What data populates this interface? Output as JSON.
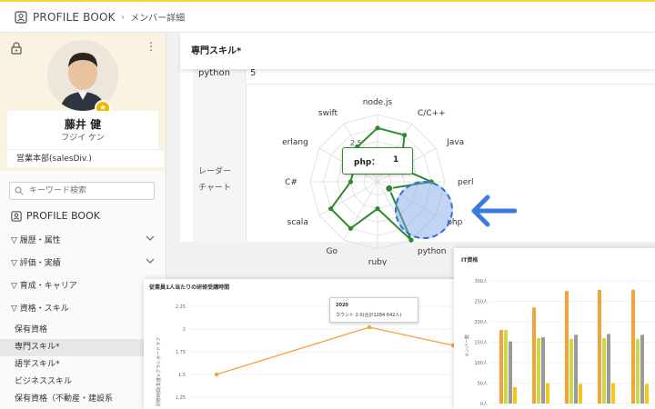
{
  "topbar": {
    "app_name": "PROFILE BOOK",
    "breadcrumb": "メンバー詳細"
  },
  "profile": {
    "name": "藤井 健",
    "kana": "フジイ ケン",
    "department": "営業本部(salesDiv.)"
  },
  "sidebar": {
    "search_placeholder": "キーワード検索",
    "nav_title": "PROFILE BOOK",
    "menu": [
      {
        "label": "▽ 履歴・属性"
      },
      {
        "label": "▽ 評価・実績"
      },
      {
        "label": "▽ 育成・キャリア"
      },
      {
        "label": "▽ 資格・スキル"
      }
    ],
    "sub_items": [
      {
        "label": "保有資格"
      },
      {
        "label": "専門スキル*"
      },
      {
        "label": "語学スキル*"
      },
      {
        "label": "ビジネススキル"
      },
      {
        "label": "保有資格（不動産・建設系"
      }
    ]
  },
  "section": {
    "title": "専門スキル*",
    "row_label": "python",
    "row_value": "5",
    "radar_label_1": "レーダー",
    "radar_label_2": "チャート"
  },
  "chart_data": [
    {
      "type": "radar",
      "axes": [
        "node.js",
        "C/C++",
        "Java",
        "perl",
        "php",
        "python",
        "ruby",
        "Go",
        "scala",
        "C#",
        "erlang",
        "swift"
      ],
      "values": [
        4,
        4,
        2,
        4,
        1,
        5,
        2,
        4,
        4,
        2,
        2,
        3
      ],
      "max": 5,
      "scale_label": "2.5",
      "tooltip": {
        "label": "php：",
        "value": "1"
      },
      "color": "#2f8a2f"
    },
    {
      "type": "line",
      "title": "従業員1人当たりの研修受講時間",
      "ylabel": "研修時間(年度×グラシボードラフ",
      "y_ticks": [
        "2.25",
        "2",
        "1.75",
        "1.5",
        "1.25"
      ],
      "values": [
        1.5,
        2.02,
        1.82
      ],
      "tooltip": {
        "title": "2020",
        "text": "カウント 2.0(合計1284 642人)"
      },
      "color": "#f2a33a"
    },
    {
      "type": "bar",
      "title": "IT資格",
      "ylabel": "メンバー数",
      "y_ticks": [
        "300人",
        "250人",
        "200人",
        "150人",
        "100人",
        "50人",
        "0人"
      ],
      "series": [
        {
          "color": "#f2a33a",
          "values": [
            180,
            235,
            275,
            278,
            278
          ]
        },
        {
          "color": "#cbd84a",
          "values": [
            180,
            160,
            158,
            160,
            158
          ]
        },
        {
          "color": "#9a9a9a",
          "values": [
            152,
            162,
            168,
            170,
            168
          ]
        },
        {
          "color": "#f5c518",
          "values": [
            40,
            50,
            48,
            50,
            48
          ]
        }
      ]
    }
  ]
}
